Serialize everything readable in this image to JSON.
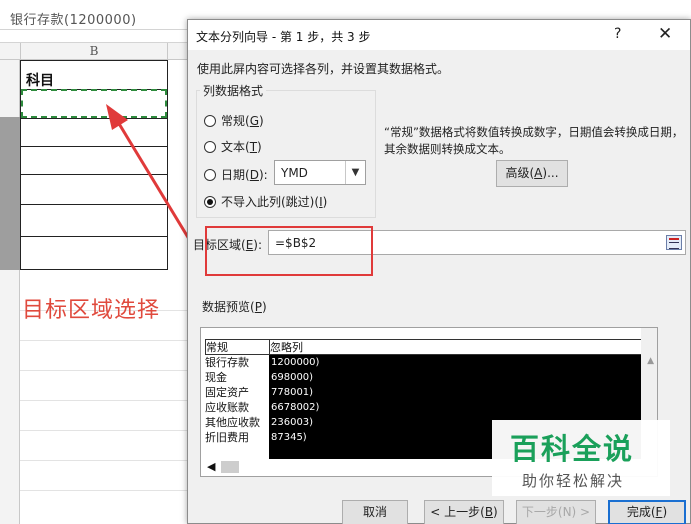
{
  "sheet": {
    "formula_text": "银行存款(1200000)",
    "column_header": "B",
    "cell_header": "科目",
    "annotation_text": "目标区域选择"
  },
  "dialog": {
    "title": "文本分列向导 - 第 1 步，共 3 步",
    "help": "?",
    "close": "✕",
    "instruction": "使用此屏内容可选择各列，并设置其数据格式。",
    "format_group_label": "列数据格式",
    "options": [
      {
        "label": "常规",
        "key": "G"
      },
      {
        "label": "文本",
        "key": "T"
      },
      {
        "label": "日期",
        "key": "D"
      },
      {
        "label": "不导入此列(跳过)",
        "key": "I"
      }
    ],
    "selected_option": "不导入此列(跳过)",
    "date_format": "YMD",
    "description": "“常规”数据格式将数值转换成数字，日期值会转换成日期，其余数据则转换成文本。",
    "advanced_button": "高级",
    "advanced_key": "A",
    "destination_label": "目标区域",
    "destination_key": "E",
    "destination_value": "=$B$2",
    "preview_label": "数据预览",
    "preview_key": "P",
    "preview_headers": [
      "常规",
      "忽略列"
    ],
    "preview_rows": [
      [
        "银行存款",
        "1200000)"
      ],
      [
        "现金",
        "698000)"
      ],
      [
        "固定资产",
        "778001)"
      ],
      [
        "应收账款",
        "6678002)"
      ],
      [
        "其他应收款",
        "236003)"
      ],
      [
        "折旧费用",
        "87345)"
      ]
    ],
    "buttons": {
      "cancel": "取消",
      "back": "< 上一步",
      "back_key": "B",
      "next": "下一步(N) >",
      "finish": "完成",
      "finish_key": "F"
    }
  },
  "watermark": {
    "main": "百科全说",
    "sub": "助你轻松解决"
  },
  "colors": {
    "annotation_red": "#e03a3a",
    "watermark_green": "#1aa05a",
    "dashed_green": "#2e8b3d",
    "focus_blue": "#1a6fd1"
  }
}
